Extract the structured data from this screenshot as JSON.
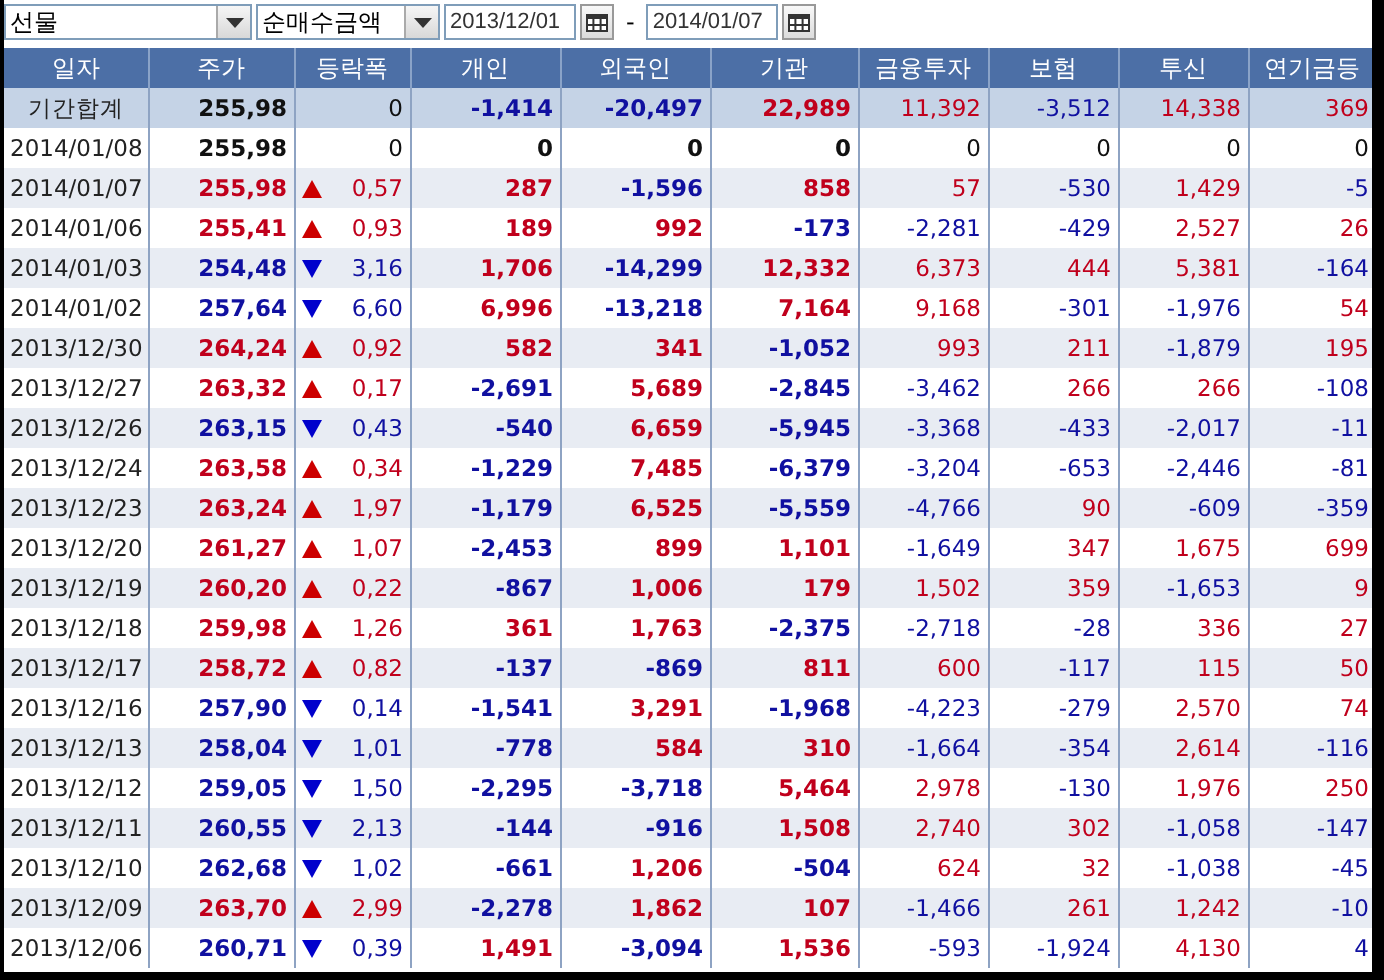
{
  "toolbar": {
    "market_select": "선물",
    "type_select": "순매수금액",
    "date_from": "2013/12/01",
    "separator": "-",
    "date_to": "2014/01/07"
  },
  "columns": [
    "일자",
    "주가",
    "등락폭",
    "개인",
    "외국인",
    "기관",
    "금융투자",
    "보험",
    "투신",
    "연기금등"
  ],
  "rows": [
    {
      "kind": "total",
      "label": "기간합계",
      "price": {
        "text": "255,98",
        "color": "#111111"
      },
      "change": {
        "kind": "none",
        "text": "0",
        "color": "#111111"
      },
      "values": [
        {
          "text": "-1,414",
          "color": "#1010a0"
        },
        {
          "text": "-20,497",
          "color": "#1010a0"
        },
        {
          "text": "22,989",
          "color": "#c0001c"
        },
        {
          "text": "11,392",
          "color": "#c0001c"
        },
        {
          "text": "-3,512",
          "color": "#1010a0"
        },
        {
          "text": "14,338",
          "color": "#c0001c"
        },
        {
          "text": "369",
          "color": "#c0001c"
        }
      ]
    },
    {
      "kind": "day",
      "label": "2014/01/08",
      "price": {
        "text": "255,98",
        "color": "#111111"
      },
      "change": {
        "kind": "none",
        "text": "0",
        "color": "#111111"
      },
      "values": [
        {
          "text": "0",
          "color": "#111111"
        },
        {
          "text": "0",
          "color": "#111111"
        },
        {
          "text": "0",
          "color": "#111111"
        },
        {
          "text": "0",
          "color": "#111111"
        },
        {
          "text": "0",
          "color": "#111111"
        },
        {
          "text": "0",
          "color": "#111111"
        },
        {
          "text": "0",
          "color": "#111111"
        }
      ]
    },
    {
      "kind": "day",
      "label": "2014/01/07",
      "price": {
        "text": "255,98",
        "color": "#c0001c"
      },
      "change": {
        "kind": "up",
        "text": "0,57",
        "color": "#c0001c"
      },
      "values": [
        {
          "text": "287",
          "color": "#c0001c"
        },
        {
          "text": "-1,596",
          "color": "#1010a0"
        },
        {
          "text": "858",
          "color": "#c0001c"
        },
        {
          "text": "57",
          "color": "#c0001c"
        },
        {
          "text": "-530",
          "color": "#1010a0"
        },
        {
          "text": "1,429",
          "color": "#c0001c"
        },
        {
          "text": "-5",
          "color": "#1010a0"
        }
      ]
    },
    {
      "kind": "day",
      "label": "2014/01/06",
      "price": {
        "text": "255,41",
        "color": "#c0001c"
      },
      "change": {
        "kind": "up",
        "text": "0,93",
        "color": "#c0001c"
      },
      "values": [
        {
          "text": "189",
          "color": "#c0001c"
        },
        {
          "text": "992",
          "color": "#c0001c"
        },
        {
          "text": "-173",
          "color": "#1010a0"
        },
        {
          "text": "-2,281",
          "color": "#1010a0"
        },
        {
          "text": "-429",
          "color": "#1010a0"
        },
        {
          "text": "2,527",
          "color": "#c0001c"
        },
        {
          "text": "26",
          "color": "#c0001c"
        }
      ]
    },
    {
      "kind": "day",
      "label": "2014/01/03",
      "price": {
        "text": "254,48",
        "color": "#1010a0"
      },
      "change": {
        "kind": "down",
        "text": "3,16",
        "color": "#1010a0"
      },
      "values": [
        {
          "text": "1,706",
          "color": "#c0001c"
        },
        {
          "text": "-14,299",
          "color": "#1010a0"
        },
        {
          "text": "12,332",
          "color": "#c0001c"
        },
        {
          "text": "6,373",
          "color": "#c0001c"
        },
        {
          "text": "444",
          "color": "#c0001c"
        },
        {
          "text": "5,381",
          "color": "#c0001c"
        },
        {
          "text": "-164",
          "color": "#1010a0"
        }
      ]
    },
    {
      "kind": "day",
      "label": "2014/01/02",
      "price": {
        "text": "257,64",
        "color": "#1010a0"
      },
      "change": {
        "kind": "down",
        "text": "6,60",
        "color": "#1010a0"
      },
      "values": [
        {
          "text": "6,996",
          "color": "#c0001c"
        },
        {
          "text": "-13,218",
          "color": "#1010a0"
        },
        {
          "text": "7,164",
          "color": "#c0001c"
        },
        {
          "text": "9,168",
          "color": "#c0001c"
        },
        {
          "text": "-301",
          "color": "#1010a0"
        },
        {
          "text": "-1,976",
          "color": "#1010a0"
        },
        {
          "text": "54",
          "color": "#c0001c"
        }
      ]
    },
    {
      "kind": "day",
      "label": "2013/12/30",
      "price": {
        "text": "264,24",
        "color": "#c0001c"
      },
      "change": {
        "kind": "up",
        "text": "0,92",
        "color": "#c0001c"
      },
      "values": [
        {
          "text": "582",
          "color": "#c0001c"
        },
        {
          "text": "341",
          "color": "#c0001c"
        },
        {
          "text": "-1,052",
          "color": "#1010a0"
        },
        {
          "text": "993",
          "color": "#c0001c"
        },
        {
          "text": "211",
          "color": "#c0001c"
        },
        {
          "text": "-1,879",
          "color": "#1010a0"
        },
        {
          "text": "195",
          "color": "#c0001c"
        }
      ]
    },
    {
      "kind": "day",
      "label": "2013/12/27",
      "price": {
        "text": "263,32",
        "color": "#c0001c"
      },
      "change": {
        "kind": "up",
        "text": "0,17",
        "color": "#c0001c"
      },
      "values": [
        {
          "text": "-2,691",
          "color": "#1010a0"
        },
        {
          "text": "5,689",
          "color": "#c0001c"
        },
        {
          "text": "-2,845",
          "color": "#1010a0"
        },
        {
          "text": "-3,462",
          "color": "#1010a0"
        },
        {
          "text": "266",
          "color": "#c0001c"
        },
        {
          "text": "266",
          "color": "#c0001c"
        },
        {
          "text": "-108",
          "color": "#1010a0"
        }
      ]
    },
    {
      "kind": "day",
      "label": "2013/12/26",
      "price": {
        "text": "263,15",
        "color": "#1010a0"
      },
      "change": {
        "kind": "down",
        "text": "0,43",
        "color": "#1010a0"
      },
      "values": [
        {
          "text": "-540",
          "color": "#1010a0"
        },
        {
          "text": "6,659",
          "color": "#c0001c"
        },
        {
          "text": "-5,945",
          "color": "#1010a0"
        },
        {
          "text": "-3,368",
          "color": "#1010a0"
        },
        {
          "text": "-433",
          "color": "#1010a0"
        },
        {
          "text": "-2,017",
          "color": "#1010a0"
        },
        {
          "text": "-11",
          "color": "#1010a0"
        }
      ]
    },
    {
      "kind": "day",
      "label": "2013/12/24",
      "price": {
        "text": "263,58",
        "color": "#c0001c"
      },
      "change": {
        "kind": "up",
        "text": "0,34",
        "color": "#c0001c"
      },
      "values": [
        {
          "text": "-1,229",
          "color": "#1010a0"
        },
        {
          "text": "7,485",
          "color": "#c0001c"
        },
        {
          "text": "-6,379",
          "color": "#1010a0"
        },
        {
          "text": "-3,204",
          "color": "#1010a0"
        },
        {
          "text": "-653",
          "color": "#1010a0"
        },
        {
          "text": "-2,446",
          "color": "#1010a0"
        },
        {
          "text": "-81",
          "color": "#1010a0"
        }
      ]
    },
    {
      "kind": "day",
      "label": "2013/12/23",
      "price": {
        "text": "263,24",
        "color": "#c0001c"
      },
      "change": {
        "kind": "up",
        "text": "1,97",
        "color": "#c0001c"
      },
      "values": [
        {
          "text": "-1,179",
          "color": "#1010a0"
        },
        {
          "text": "6,525",
          "color": "#c0001c"
        },
        {
          "text": "-5,559",
          "color": "#1010a0"
        },
        {
          "text": "-4,766",
          "color": "#1010a0"
        },
        {
          "text": "90",
          "color": "#c0001c"
        },
        {
          "text": "-609",
          "color": "#1010a0"
        },
        {
          "text": "-359",
          "color": "#1010a0"
        }
      ]
    },
    {
      "kind": "day",
      "label": "2013/12/20",
      "price": {
        "text": "261,27",
        "color": "#c0001c"
      },
      "change": {
        "kind": "up",
        "text": "1,07",
        "color": "#c0001c"
      },
      "values": [
        {
          "text": "-2,453",
          "color": "#1010a0"
        },
        {
          "text": "899",
          "color": "#c0001c"
        },
        {
          "text": "1,101",
          "color": "#c0001c"
        },
        {
          "text": "-1,649",
          "color": "#1010a0"
        },
        {
          "text": "347",
          "color": "#c0001c"
        },
        {
          "text": "1,675",
          "color": "#c0001c"
        },
        {
          "text": "699",
          "color": "#c0001c"
        }
      ]
    },
    {
      "kind": "day",
      "label": "2013/12/19",
      "price": {
        "text": "260,20",
        "color": "#c0001c"
      },
      "change": {
        "kind": "up",
        "text": "0,22",
        "color": "#c0001c"
      },
      "values": [
        {
          "text": "-867",
          "color": "#1010a0"
        },
        {
          "text": "1,006",
          "color": "#c0001c"
        },
        {
          "text": "179",
          "color": "#c0001c"
        },
        {
          "text": "1,502",
          "color": "#c0001c"
        },
        {
          "text": "359",
          "color": "#c0001c"
        },
        {
          "text": "-1,653",
          "color": "#1010a0"
        },
        {
          "text": "9",
          "color": "#c0001c"
        }
      ]
    },
    {
      "kind": "day",
      "label": "2013/12/18",
      "price": {
        "text": "259,98",
        "color": "#c0001c"
      },
      "change": {
        "kind": "up",
        "text": "1,26",
        "color": "#c0001c"
      },
      "values": [
        {
          "text": "361",
          "color": "#c0001c"
        },
        {
          "text": "1,763",
          "color": "#c0001c"
        },
        {
          "text": "-2,375",
          "color": "#1010a0"
        },
        {
          "text": "-2,718",
          "color": "#1010a0"
        },
        {
          "text": "-28",
          "color": "#1010a0"
        },
        {
          "text": "336",
          "color": "#c0001c"
        },
        {
          "text": "27",
          "color": "#c0001c"
        }
      ]
    },
    {
      "kind": "day",
      "label": "2013/12/17",
      "price": {
        "text": "258,72",
        "color": "#c0001c"
      },
      "change": {
        "kind": "up",
        "text": "0,82",
        "color": "#c0001c"
      },
      "values": [
        {
          "text": "-137",
          "color": "#1010a0"
        },
        {
          "text": "-869",
          "color": "#1010a0"
        },
        {
          "text": "811",
          "color": "#c0001c"
        },
        {
          "text": "600",
          "color": "#c0001c"
        },
        {
          "text": "-117",
          "color": "#1010a0"
        },
        {
          "text": "115",
          "color": "#c0001c"
        },
        {
          "text": "50",
          "color": "#c0001c"
        }
      ]
    },
    {
      "kind": "day",
      "label": "2013/12/16",
      "price": {
        "text": "257,90",
        "color": "#1010a0"
      },
      "change": {
        "kind": "down",
        "text": "0,14",
        "color": "#1010a0"
      },
      "values": [
        {
          "text": "-1,541",
          "color": "#1010a0"
        },
        {
          "text": "3,291",
          "color": "#c0001c"
        },
        {
          "text": "-1,968",
          "color": "#1010a0"
        },
        {
          "text": "-4,223",
          "color": "#1010a0"
        },
        {
          "text": "-279",
          "color": "#1010a0"
        },
        {
          "text": "2,570",
          "color": "#c0001c"
        },
        {
          "text": "74",
          "color": "#c0001c"
        }
      ]
    },
    {
      "kind": "day",
      "label": "2013/12/13",
      "price": {
        "text": "258,04",
        "color": "#1010a0"
      },
      "change": {
        "kind": "down",
        "text": "1,01",
        "color": "#1010a0"
      },
      "values": [
        {
          "text": "-778",
          "color": "#1010a0"
        },
        {
          "text": "584",
          "color": "#c0001c"
        },
        {
          "text": "310",
          "color": "#c0001c"
        },
        {
          "text": "-1,664",
          "color": "#1010a0"
        },
        {
          "text": "-354",
          "color": "#1010a0"
        },
        {
          "text": "2,614",
          "color": "#c0001c"
        },
        {
          "text": "-116",
          "color": "#1010a0"
        }
      ]
    },
    {
      "kind": "day",
      "label": "2013/12/12",
      "price": {
        "text": "259,05",
        "color": "#1010a0"
      },
      "change": {
        "kind": "down",
        "text": "1,50",
        "color": "#1010a0"
      },
      "values": [
        {
          "text": "-2,295",
          "color": "#1010a0"
        },
        {
          "text": "-3,718",
          "color": "#1010a0"
        },
        {
          "text": "5,464",
          "color": "#c0001c"
        },
        {
          "text": "2,978",
          "color": "#c0001c"
        },
        {
          "text": "-130",
          "color": "#1010a0"
        },
        {
          "text": "1,976",
          "color": "#c0001c"
        },
        {
          "text": "250",
          "color": "#c0001c"
        }
      ]
    },
    {
      "kind": "day",
      "label": "2013/12/11",
      "price": {
        "text": "260,55",
        "color": "#1010a0"
      },
      "change": {
        "kind": "down",
        "text": "2,13",
        "color": "#1010a0"
      },
      "values": [
        {
          "text": "-144",
          "color": "#1010a0"
        },
        {
          "text": "-916",
          "color": "#1010a0"
        },
        {
          "text": "1,508",
          "color": "#c0001c"
        },
        {
          "text": "2,740",
          "color": "#c0001c"
        },
        {
          "text": "302",
          "color": "#c0001c"
        },
        {
          "text": "-1,058",
          "color": "#1010a0"
        },
        {
          "text": "-147",
          "color": "#1010a0"
        }
      ]
    },
    {
      "kind": "day",
      "label": "2013/12/10",
      "price": {
        "text": "262,68",
        "color": "#1010a0"
      },
      "change": {
        "kind": "down",
        "text": "1,02",
        "color": "#1010a0"
      },
      "values": [
        {
          "text": "-661",
          "color": "#1010a0"
        },
        {
          "text": "1,206",
          "color": "#c0001c"
        },
        {
          "text": "-504",
          "color": "#1010a0"
        },
        {
          "text": "624",
          "color": "#c0001c"
        },
        {
          "text": "32",
          "color": "#c0001c"
        },
        {
          "text": "-1,038",
          "color": "#1010a0"
        },
        {
          "text": "-45",
          "color": "#1010a0"
        }
      ]
    },
    {
      "kind": "day",
      "label": "2013/12/09",
      "price": {
        "text": "263,70",
        "color": "#c0001c"
      },
      "change": {
        "kind": "up",
        "text": "2,99",
        "color": "#c0001c"
      },
      "values": [
        {
          "text": "-2,278",
          "color": "#1010a0"
        },
        {
          "text": "1,862",
          "color": "#c0001c"
        },
        {
          "text": "107",
          "color": "#c0001c"
        },
        {
          "text": "-1,466",
          "color": "#1010a0"
        },
        {
          "text": "261",
          "color": "#c0001c"
        },
        {
          "text": "1,242",
          "color": "#c0001c"
        },
        {
          "text": "-10",
          "color": "#1010a0"
        }
      ]
    },
    {
      "kind": "day",
      "label": "2013/12/06",
      "price": {
        "text": "260,71",
        "color": "#1010a0"
      },
      "change": {
        "kind": "down",
        "text": "0,39",
        "color": "#1010a0"
      },
      "values": [
        {
          "text": "1,491",
          "color": "#c0001c"
        },
        {
          "text": "-3,094",
          "color": "#1010a0"
        },
        {
          "text": "1,536",
          "color": "#c0001c"
        },
        {
          "text": "-593",
          "color": "#1010a0"
        },
        {
          "text": "-1,924",
          "color": "#1010a0"
        },
        {
          "text": "4,130",
          "color": "#c0001c"
        },
        {
          "text": "4",
          "color": "#1010a0"
        }
      ]
    }
  ]
}
